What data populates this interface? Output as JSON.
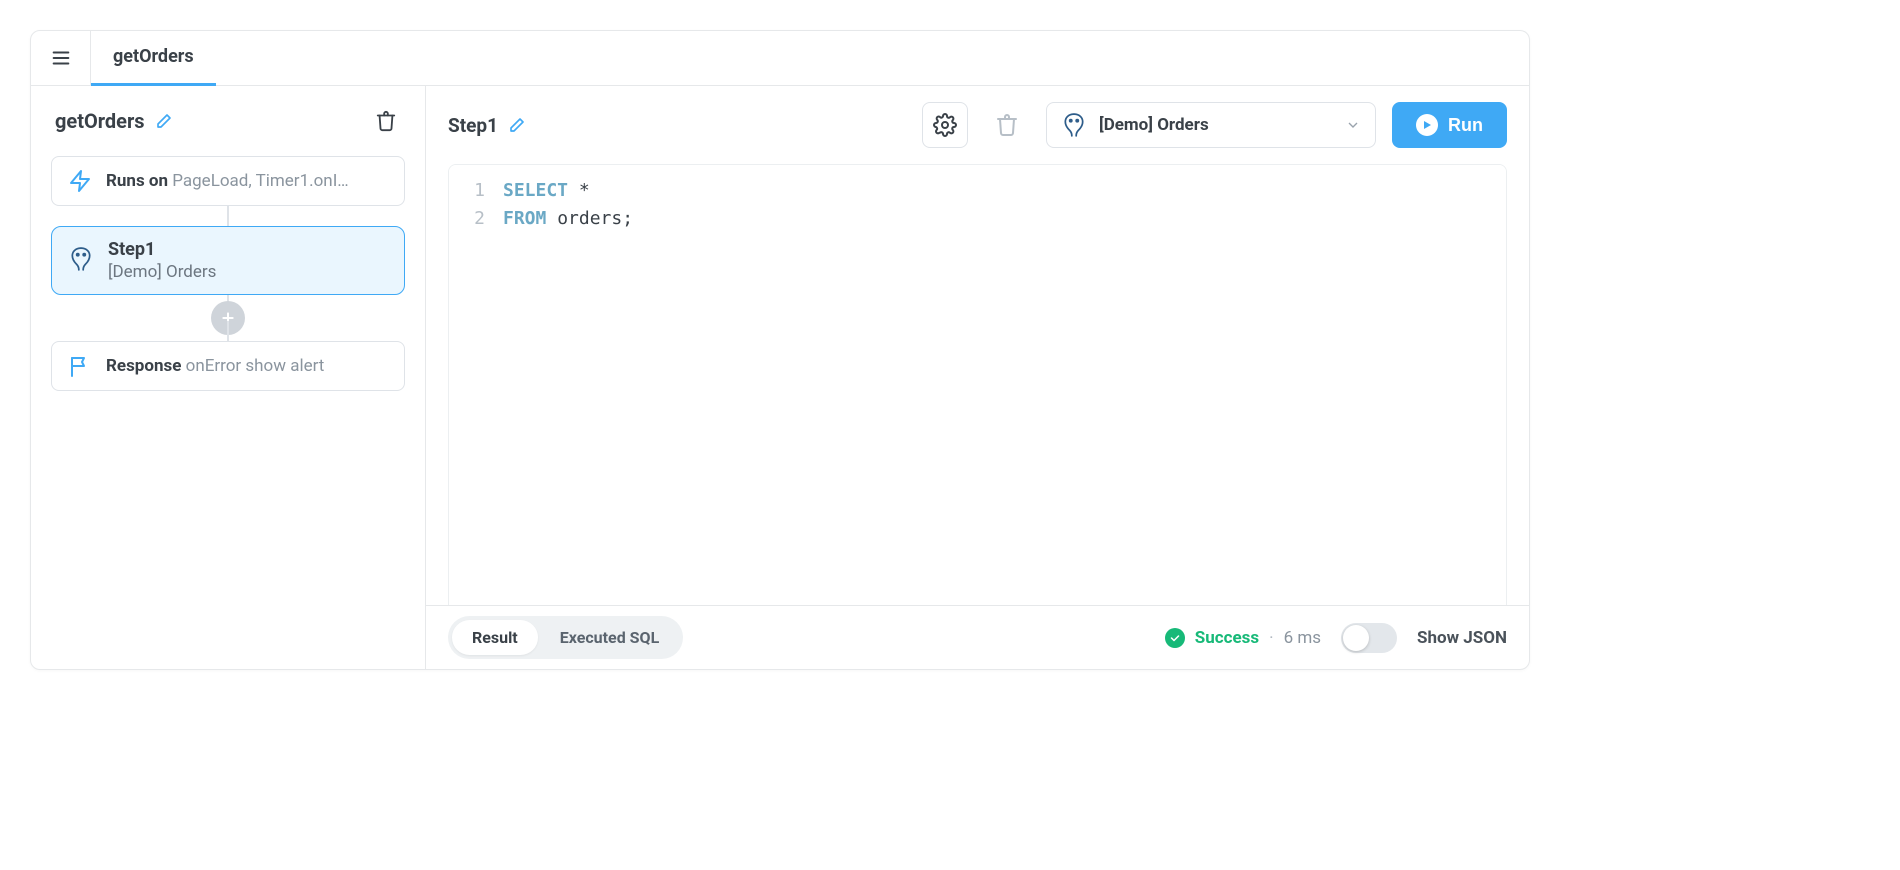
{
  "topbar": {
    "tab_label": "getOrders"
  },
  "sidebar": {
    "title": "getOrders",
    "trigger": {
      "label": "Runs on",
      "value": "PageLoad, Timer1.onI…"
    },
    "step": {
      "name": "Step1",
      "datasource": "[Demo] Orders"
    },
    "response": {
      "label": "Response",
      "value": "onError show alert"
    }
  },
  "main": {
    "step_name": "Step1",
    "datasource_label": "[Demo] Orders",
    "run_label": "Run",
    "code": {
      "line1_kw": "SELECT",
      "line1_rest": " *",
      "line2_kw": "FROM",
      "line2_rest": " orders;"
    }
  },
  "footer": {
    "tab_result": "Result",
    "tab_executed": "Executed SQL",
    "status_label": "Success",
    "status_time": "6 ms",
    "toggle_label": "Show JSON"
  }
}
